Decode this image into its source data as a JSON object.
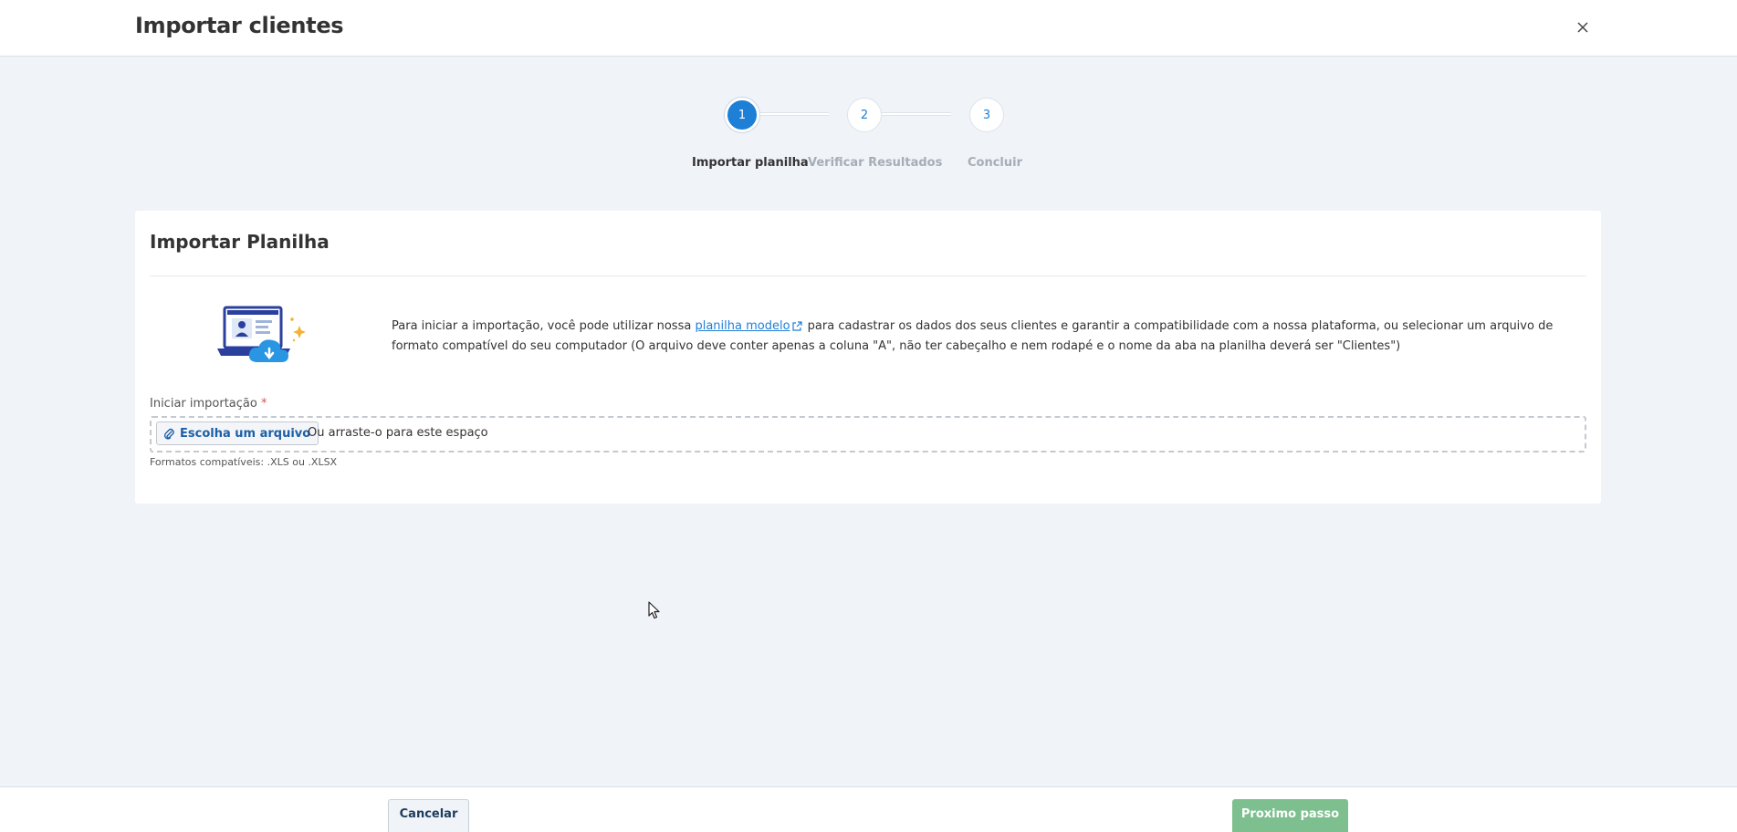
{
  "header": {
    "title": "Importar clientes",
    "close_icon": "close-icon"
  },
  "stepper": {
    "steps": [
      {
        "number": "1",
        "label": "Importar planilha",
        "state": "active"
      },
      {
        "number": "2",
        "label": "Verificar Resultados",
        "state": "inactive"
      },
      {
        "number": "3",
        "label": "Concluir",
        "state": "inactive"
      }
    ]
  },
  "card": {
    "title": "Importar Planilha",
    "description": {
      "before_link": "Para iniciar a importação, você pode utilizar nossa ",
      "link_text": "planilha modelo",
      "after_link": " para cadastrar os dados dos seus clientes e garantir a compatibilidade com a nossa plataforma, ou selecionar um arquivo de formato compatível do seu computador (O arquivo deve conter apenas a coluna \"A\", não ter cabeçalho e nem rodapé e o nome da aba na planilha deverá ser \"Clientes\")"
    },
    "upload": {
      "label": "Iniciar importação",
      "required_mark": "*",
      "button_label": "Escolha um arquivo",
      "button_icon": "paperclip-icon",
      "drop_hint": "Ou arraste-o para este espaço",
      "formats": "Formatos compatíveis: .XLS ou .XLSX"
    }
  },
  "footer": {
    "cancel_label": "Cancelar",
    "next_label": "Proximo passo"
  },
  "colors": {
    "accent": "#1e7fd6",
    "next_button_disabled": "#7dbf8e",
    "background": "#f0f3f7"
  }
}
